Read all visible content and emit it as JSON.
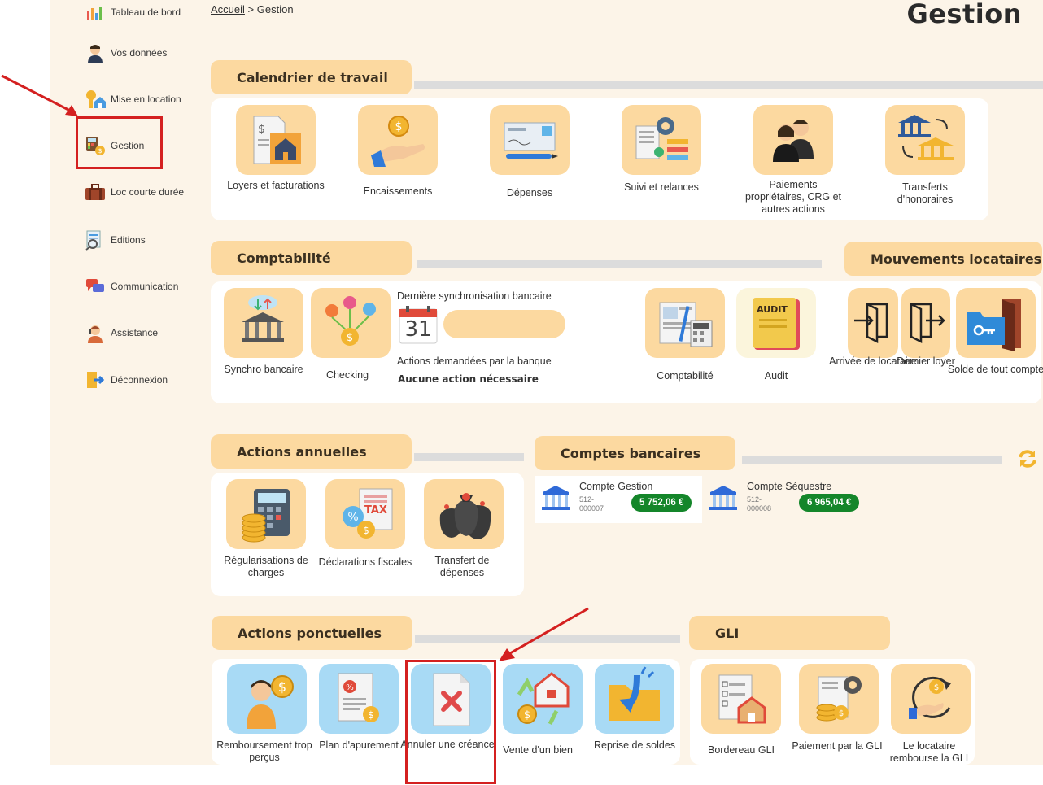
{
  "sidebar": {
    "items": [
      {
        "label": "Tableau de bord",
        "icon": "dashboard-icon"
      },
      {
        "label": "Vos données",
        "icon": "user-icon"
      },
      {
        "label": "Mise en location",
        "icon": "key-house-icon"
      },
      {
        "label": "Gestion",
        "icon": "calculator-money-icon"
      },
      {
        "label": "Loc courte durée",
        "icon": "suitcase-icon"
      },
      {
        "label": "Editions",
        "icon": "print-icon"
      },
      {
        "label": "Communication",
        "icon": "chat-icon"
      },
      {
        "label": "Assistance",
        "icon": "support-icon"
      },
      {
        "label": "Déconnexion",
        "icon": "logout-icon"
      }
    ]
  },
  "breadcrumb": {
    "home": "Accueil",
    "sep": ">",
    "current": "Gestion"
  },
  "page_title": "Gestion",
  "calendrier": {
    "title": "Calendrier de travail",
    "tiles": [
      {
        "label": "Loyers et facturations",
        "icon": "invoice-house-icon"
      },
      {
        "label": "Encaissements",
        "icon": "hand-coin-icon"
      },
      {
        "label": "Dépenses",
        "icon": "check-pen-icon"
      },
      {
        "label": "Suivi et relances",
        "icon": "gear-list-icon"
      },
      {
        "label": "Paiements propriétaires, CRG et autres actions",
        "icon": "owners-icon"
      },
      {
        "label": "Transferts d'honoraires",
        "icon": "bank-transfer-icon"
      }
    ]
  },
  "comptabilite": {
    "title": "Comptabilité",
    "synchro_label": "Synchro bancaire",
    "checking_label": "Checking",
    "last_sync_label": "Dernière synchronisation bancaire",
    "calendar_day": "31",
    "bank_actions_label": "Actions demandées par la banque",
    "bank_actions_value": "Aucune action nécessaire",
    "compta_label": "Comptabilité",
    "audit_label": "Audit",
    "audit_word": "AUDIT"
  },
  "mouvements": {
    "title": "Mouvements locataires",
    "tiles": [
      {
        "label": "Arrivée de locataire",
        "icon": "door-enter-icon"
      },
      {
        "label": "Dernier loyer",
        "icon": "door-exit-icon"
      },
      {
        "label": "Solde de tout compte",
        "icon": "folder-key-door-icon"
      }
    ]
  },
  "annuelles": {
    "title": "Actions annuelles",
    "tiles": [
      {
        "label": "Régularisations de charges",
        "icon": "calculator-coins-icon"
      },
      {
        "label": "Déclarations fiscales",
        "icon": "tax-icon"
      },
      {
        "label": "Transfert de dépenses",
        "icon": "money-bags-icon"
      }
    ],
    "tax_word": "TAX"
  },
  "comptes": {
    "title": "Comptes bancaires",
    "accounts": [
      {
        "name": "Compte Gestion",
        "number": "512-000007",
        "balance": "5 752,06 €"
      },
      {
        "name": "Compte Séquestre",
        "number": "512-000008",
        "balance": "6 965,04 €"
      }
    ],
    "balance_color": "#14862a"
  },
  "ponctuelles": {
    "title": "Actions ponctuelles",
    "tiles": [
      {
        "label": "Remboursement trop perçus",
        "icon": "person-coin-icon"
      },
      {
        "label": "Plan d'apurement",
        "icon": "percent-document-icon"
      },
      {
        "label": "Annuler une créance",
        "icon": "cancel-document-icon"
      },
      {
        "label": "Vente d'un bien",
        "icon": "house-sale-icon"
      },
      {
        "label": "Reprise de soldes",
        "icon": "folder-arrow-icon"
      }
    ]
  },
  "gli": {
    "title": "GLI",
    "tiles": [
      {
        "label": "Bordereau GLI",
        "icon": "checklist-house-icon"
      },
      {
        "label": "Paiement par la GLI",
        "icon": "gear-payment-icon"
      },
      {
        "label": "Le locataire rembourse la GLI",
        "icon": "refund-hand-icon"
      }
    ]
  },
  "colors": {
    "tile_orange": "#fcd9a0",
    "tile_blue": "#a8daf5",
    "annotation_red": "#d42020"
  }
}
